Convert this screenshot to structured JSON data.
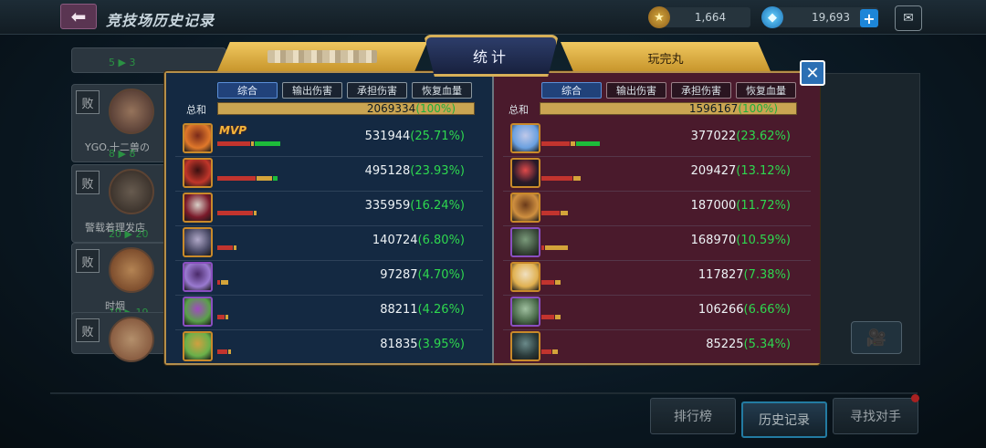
{
  "header": {
    "title": "竞技场历史记录",
    "back_icon": "back-arrow-icon"
  },
  "currency": {
    "gold": "1,664",
    "gems": "19,693",
    "add_label": "+"
  },
  "background_list": [
    {
      "status": "败",
      "name": "",
      "score_a": "5",
      "score_b": "3"
    },
    {
      "status": "败",
      "name": "YGO.十二兽の",
      "score_a": "8",
      "score_b": "8"
    },
    {
      "status": "败",
      "name": "警载着理发店",
      "score_a": "20",
      "score_b": "20"
    },
    {
      "status": "败",
      "name": "时烟",
      "score_a": "19",
      "score_b": "19"
    },
    {
      "status": "败",
      "name": "",
      "score_a": "",
      "score_b": ""
    }
  ],
  "dialog": {
    "title": "统计",
    "left_player": "",
    "right_player": "玩完丸",
    "tabs": [
      "综合",
      "输出伤害",
      "承担伤害",
      "恢复血量"
    ],
    "active_tab": "综合",
    "total_label": "总和",
    "left": {
      "total": "2069334",
      "total_pct": "(100%)",
      "rows": [
        {
          "value": "531944",
          "pct": "(25.71%)",
          "mvp": "MVP",
          "bars": [
            0.13,
            0.01,
            0.1
          ]
        },
        {
          "value": "495128",
          "pct": "(23.93%)",
          "mvp": "",
          "bars": [
            0.15,
            0.06,
            0.02
          ]
        },
        {
          "value": "335959",
          "pct": "(16.24%)",
          "mvp": "",
          "bars": [
            0.14,
            0.01,
            0
          ]
        },
        {
          "value": "140724",
          "pct": "(6.80%)",
          "mvp": "",
          "bars": [
            0.06,
            0.01,
            0
          ]
        },
        {
          "value": "97287",
          "pct": "(4.70%)",
          "mvp": "",
          "bars": [
            0.01,
            0.03,
            0
          ]
        },
        {
          "value": "88211",
          "pct": "(4.26%)",
          "mvp": "",
          "bars": [
            0.03,
            0.01,
            0
          ]
        },
        {
          "value": "81835",
          "pct": "(3.95%)",
          "mvp": "",
          "bars": [
            0.04,
            0.01,
            0
          ]
        }
      ]
    },
    "right": {
      "total": "1596167",
      "total_pct": "(100%)",
      "rows": [
        {
          "value": "377022",
          "pct": "(23.62%)",
          "bars": [
            0.11,
            0.02,
            0.09
          ]
        },
        {
          "value": "209427",
          "pct": "(13.12%)",
          "bars": [
            0.12,
            0.03,
            0
          ]
        },
        {
          "value": "187000",
          "pct": "(11.72%)",
          "bars": [
            0.07,
            0.03,
            0
          ]
        },
        {
          "value": "168970",
          "pct": "(10.59%)",
          "bars": [
            0.01,
            0.09,
            0
          ]
        },
        {
          "value": "117827",
          "pct": "(7.38%)",
          "bars": [
            0.05,
            0.02,
            0
          ]
        },
        {
          "value": "106266",
          "pct": "(6.66%)",
          "bars": [
            0.05,
            0.02,
            0
          ]
        },
        {
          "value": "85225",
          "pct": "(5.34%)",
          "bars": [
            0.04,
            0.02,
            0
          ]
        }
      ]
    }
  },
  "bottom_tabs": [
    "排行榜",
    "历史记录",
    "寻找对手"
  ],
  "active_bottom_tab": "历史记录",
  "colors": {
    "gold": "#caa552",
    "left_bg": "#142942",
    "right_bg": "#4a1a2c",
    "pct_green": "#2ed84f"
  }
}
